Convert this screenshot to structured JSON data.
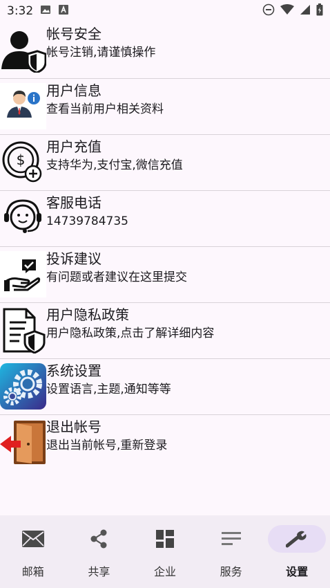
{
  "status_bar": {
    "time": "3:32",
    "icons": [
      "image-icon",
      "text-a-icon",
      "do-not-disturb-icon",
      "wifi-icon",
      "signal-icon",
      "battery-icon"
    ]
  },
  "menu": {
    "items": [
      {
        "icon": "account-security-icon",
        "title": "帐号安全",
        "subtitle": "帐号注销,请谨慎操作"
      },
      {
        "icon": "user-info-icon",
        "title": "用户信息",
        "subtitle": "查看当前用户相关资料"
      },
      {
        "icon": "recharge-icon",
        "title": "用户充值",
        "subtitle": "支持华为,支付宝,微信充值"
      },
      {
        "icon": "customer-service-icon",
        "title": "客服电话",
        "subtitle": "14739784735"
      },
      {
        "icon": "complaint-icon",
        "title": "投诉建议",
        "subtitle": "有问题或者建议在这里提交"
      },
      {
        "icon": "privacy-policy-icon",
        "title": "用户隐私政策",
        "subtitle": "用户隐私政策,点击了解详细内容"
      },
      {
        "icon": "system-settings-icon",
        "title": "系统设置",
        "subtitle": "设置语言,主题,通知等等"
      },
      {
        "icon": "logout-icon",
        "title": "退出帐号",
        "subtitle": "退出当前帐号,重新登录"
      }
    ]
  },
  "bottom_nav": {
    "items": [
      {
        "icon": "mail-icon",
        "label": "邮箱"
      },
      {
        "icon": "share-icon",
        "label": "共享"
      },
      {
        "icon": "dashboard-icon",
        "label": "企业"
      },
      {
        "icon": "notes-icon",
        "label": "服务"
      },
      {
        "icon": "wrench-icon",
        "label": "设置"
      }
    ],
    "active": "设置"
  },
  "colors": {
    "background": "#fdf7fd",
    "nav_background": "#f2ecf4",
    "nav_active_pill": "#e7ddf5",
    "divider": "#d8d2d8"
  }
}
